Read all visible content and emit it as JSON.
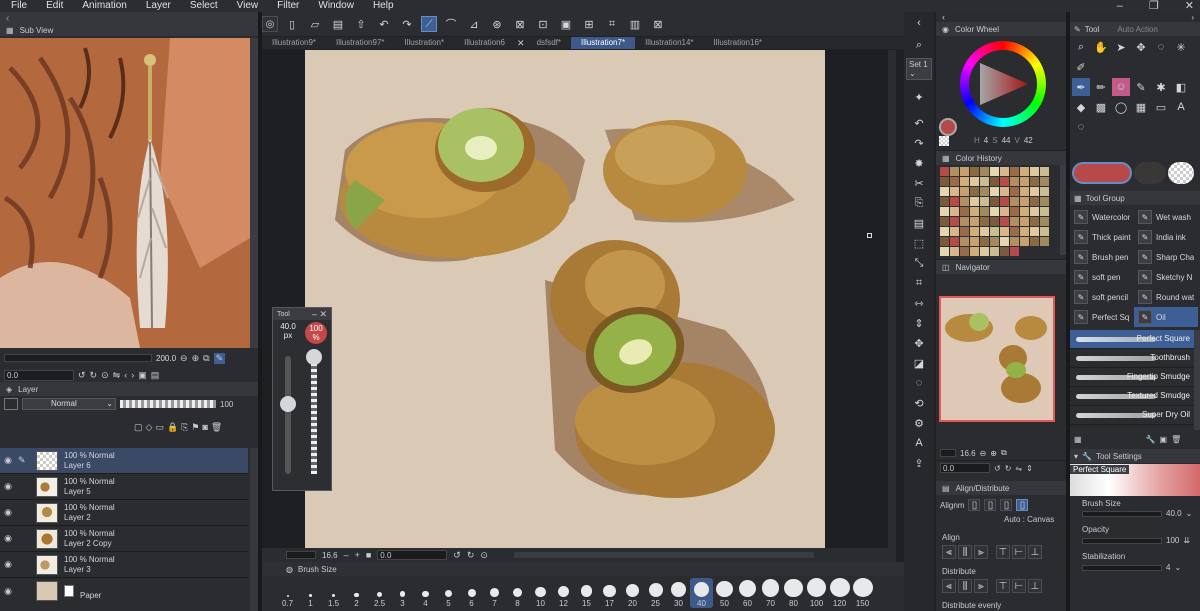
{
  "menu": [
    "File",
    "Edit",
    "Animation",
    "Layer",
    "Select",
    "View",
    "Filter",
    "Window",
    "Help"
  ],
  "window_controls": [
    "–",
    "❐",
    "✕"
  ],
  "doc_tabs": [
    "Illustration9*",
    "Illustration97*",
    "Illustration*",
    "Illustration6",
    "dsfsdf*",
    "Illustration7*",
    "Illustration14*",
    "Illustration16*"
  ],
  "active_tab_index": 5,
  "subview": {
    "title": "Sub View",
    "zoom": "200.0",
    "angle": "0.0"
  },
  "layer_panel": {
    "title": "Layer",
    "blend_mode": "Normal",
    "opacity": "100",
    "layers": [
      {
        "mode": "100 % Normal",
        "name": "Layer 6",
        "selected": true
      },
      {
        "mode": "100 % Normal",
        "name": "Layer 5",
        "selected": false
      },
      {
        "mode": "100 % Normal",
        "name": "Layer 2",
        "selected": false
      },
      {
        "mode": "100 % Normal",
        "name": "Layer 2 Copy",
        "selected": false
      },
      {
        "mode": "100 % Normal",
        "name": "Layer 3",
        "selected": false
      }
    ],
    "paper_label": "Paper"
  },
  "tool_popup": {
    "title": "Tool",
    "size": "40.0",
    "size_unit": "px",
    "opacity": "100",
    "opacity_unit": "%"
  },
  "canvas_status": {
    "zoom": "16.6",
    "angle": "0.0"
  },
  "brush_size_bar": {
    "title": "Brush Size",
    "sizes": [
      "0.7",
      "1",
      "1.5",
      "2",
      "2.5",
      "3",
      "4",
      "5",
      "6",
      "7",
      "8",
      "10",
      "12",
      "15",
      "17",
      "20",
      "25",
      "30",
      "40",
      "50",
      "60",
      "70",
      "80",
      "100",
      "120",
      "150"
    ],
    "selected": "40"
  },
  "right_toolbar": {
    "set_label": "Set 1"
  },
  "color_wheel": {
    "title": "Color Wheel",
    "h": "4",
    "s": "44",
    "v": "42",
    "main_color": "#b6494a"
  },
  "color_history": {
    "title": "Color History"
  },
  "navigator": {
    "title": "Navigator",
    "zoom": "16.6",
    "angle": "0.0"
  },
  "align": {
    "title": "Align/Distribute",
    "alignment_label": "Alignm",
    "target": "Auto : Canvas",
    "align_label": "Align",
    "distribute_label": "Distribute",
    "distribute_evenly": "Distribute evenly"
  },
  "tool_panel": {
    "tab_tool": "Tool",
    "tab_auto": "Auto Action"
  },
  "tool_group": {
    "title": "Tool Group"
  },
  "subtools": [
    [
      "Watercolor",
      "Wet wash"
    ],
    [
      "Thick paint",
      "India ink"
    ],
    [
      "Brush pen",
      "Sharp Cha"
    ],
    [
      "soft pen",
      "Sketchy N"
    ],
    [
      "soft pencil",
      "Round wat"
    ],
    [
      "Perfect Sq",
      "Oil"
    ]
  ],
  "brush_list": [
    "Perfect Square",
    "Toothbrush",
    "Fingertip Smudge",
    "Textured Smudge",
    "Super Dry Oil"
  ],
  "tool_settings": {
    "title": "Tool Settings",
    "brush_name": "Perfect Square",
    "brush_size_label": "Brush Size",
    "brush_size": "40.0",
    "opacity_label": "Opacity",
    "opacity": "100",
    "stabilization_label": "Stabilization",
    "stabilization": "4"
  }
}
